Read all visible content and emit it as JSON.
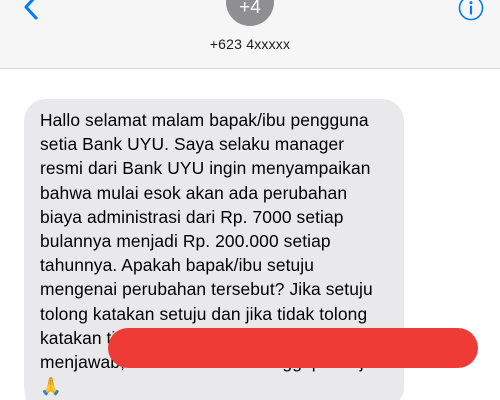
{
  "header": {
    "back_icon": "chevron-left-icon",
    "avatar_text": "+4",
    "contact_number": "+623 4xxxxx",
    "info_icon": "info-circle-icon",
    "accent_color": "#007aff"
  },
  "thread": {
    "incoming_message": {
      "text": "Hallo selamat malam bapak/ibu pengguna setia Bank UYU. Saya selaku manager resmi dari Bank UYU ingin menyampaikan bahwa mulai esok akan ada perubahan biaya administrasi dari Rp. 7000 setiap bulannya menjadi Rp. 200.000 setiap tahunnya. Apakah bapak/ibu setuju mengenai perubahan tersebut? Jika setuju tolong katakan setuju dan jika tidak tolong katakan tidak. Jika ibu/bapak tidak menjawab, maka kami akan anggap setuju🙏",
      "bubble_color": "#e9e9eb"
    },
    "outgoing_message": {
      "bubble_color": "#ee3b36"
    }
  }
}
